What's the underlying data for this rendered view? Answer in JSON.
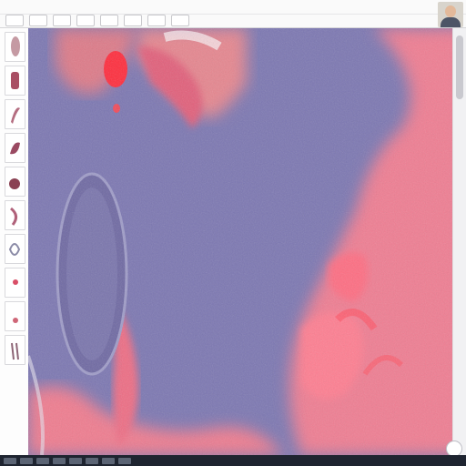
{
  "window": {
    "title": ""
  },
  "toolbar": {
    "buttons": [
      "",
      "",
      "",
      "",
      "",
      "",
      "",
      "",
      ""
    ]
  },
  "sidebar": {
    "thumbnails": [
      "slide-1",
      "slide-2",
      "slide-3",
      "slide-4",
      "slide-5",
      "slide-6",
      "slide-7",
      "slide-8",
      "slide-9",
      "slide-10"
    ]
  },
  "viewer": {
    "stain": "H&E",
    "colors": {
      "nuclear": "#7c77b2",
      "eosin": "#f07d92",
      "vessel": "#ff2d3d"
    }
  },
  "taskbar": {
    "clock": ""
  }
}
